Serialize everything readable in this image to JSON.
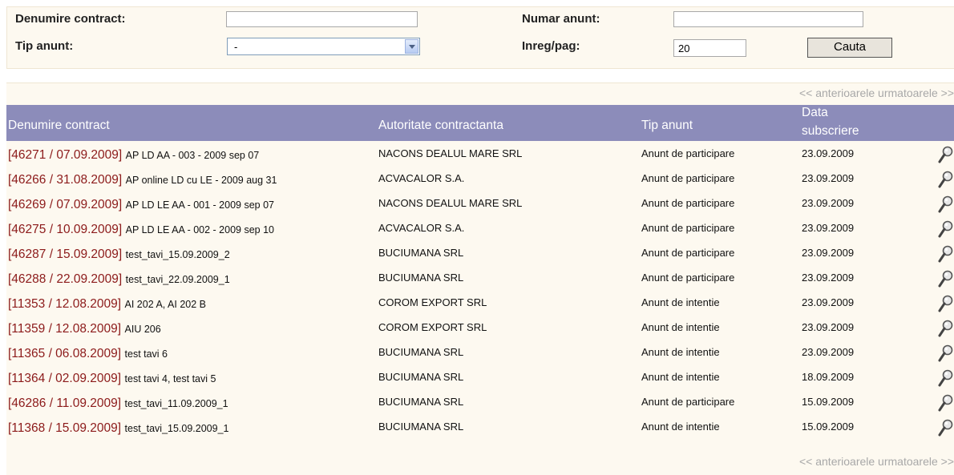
{
  "search": {
    "denumire_label": "Denumire contract:",
    "denumire_value": "",
    "numar_label": "Numar anunt:",
    "numar_value": "",
    "tip_label": "Tip anunt:",
    "tip_selected": "-",
    "inreg_label": "Inreg/pag:",
    "inreg_value": "20",
    "cauta_label": "Cauta"
  },
  "pager": {
    "text": "<< anterioarele urmatoarele >>"
  },
  "table": {
    "headers": {
      "denumire": "Denumire contract",
      "autoritate": "Autoritate contractanta",
      "tip": "Tip anunt",
      "data_line1": "Data",
      "data_line2": "subscriere"
    },
    "rows": [
      {
        "code": "[46271 / 07.09.2009]",
        "name": "AP LD AA - 003 - 2009 sep 07",
        "autoritate": "NACONS DEALUL MARE SRL",
        "tip": "Anunt de participare",
        "data": "23.09.2009"
      },
      {
        "code": "[46266 / 31.08.2009]",
        "name": "AP online LD cu LE - 2009 aug 31",
        "autoritate": "ACVACALOR S.A.",
        "tip": "Anunt de participare",
        "data": "23.09.2009"
      },
      {
        "code": "[46269 / 07.09.2009]",
        "name": "AP LD LE AA - 001 - 2009 sep 07",
        "autoritate": "NACONS DEALUL MARE SRL",
        "tip": "Anunt de participare",
        "data": "23.09.2009"
      },
      {
        "code": "[46275 / 10.09.2009]",
        "name": "AP LD LE AA - 002 - 2009 sep 10",
        "autoritate": "ACVACALOR S.A.",
        "tip": "Anunt de participare",
        "data": "23.09.2009"
      },
      {
        "code": "[46287 / 15.09.2009]",
        "name": "test_tavi_15.09.2009_2",
        "autoritate": "BUCIUMANA SRL",
        "tip": "Anunt de participare",
        "data": "23.09.2009"
      },
      {
        "code": "[46288 / 22.09.2009]",
        "name": "test_tavi_22.09.2009_1",
        "autoritate": "BUCIUMANA SRL",
        "tip": "Anunt de participare",
        "data": "23.09.2009"
      },
      {
        "code": "[11353 / 12.08.2009]",
        "name": "AI 202 A, AI 202 B",
        "autoritate": "COROM EXPORT SRL",
        "tip": "Anunt de intentie",
        "data": "23.09.2009"
      },
      {
        "code": "[11359 / 12.08.2009]",
        "name": "AIU 206",
        "autoritate": "COROM EXPORT SRL",
        "tip": "Anunt de intentie",
        "data": "23.09.2009"
      },
      {
        "code": "[11365 / 06.08.2009]",
        "name": "test tavi 6",
        "autoritate": "BUCIUMANA SRL",
        "tip": "Anunt de intentie",
        "data": "23.09.2009"
      },
      {
        "code": "[11364 / 02.09.2009]",
        "name": "test tavi 4, test tavi 5",
        "autoritate": "BUCIUMANA SRL",
        "tip": "Anunt de intentie",
        "data": "18.09.2009"
      },
      {
        "code": "[46286 / 11.09.2009]",
        "name": "test_tavi_11.09.2009_1",
        "autoritate": "BUCIUMANA SRL",
        "tip": "Anunt de participare",
        "data": "15.09.2009"
      },
      {
        "code": "[11368 / 15.09.2009]",
        "name": "test_tavi_15.09.2009_1",
        "autoritate": "BUCIUMANA SRL",
        "tip": "Anunt de intentie",
        "data": "15.09.2009"
      }
    ]
  },
  "icons": {
    "row_action": "magnifier-icon",
    "select_arrow": "chevron-down-icon"
  },
  "colors": {
    "header_bg": "#8c8cba",
    "code_text": "#8c1a1a",
    "panel_bg": "#fdf9f0",
    "pager_text": "#a8a8a8"
  }
}
